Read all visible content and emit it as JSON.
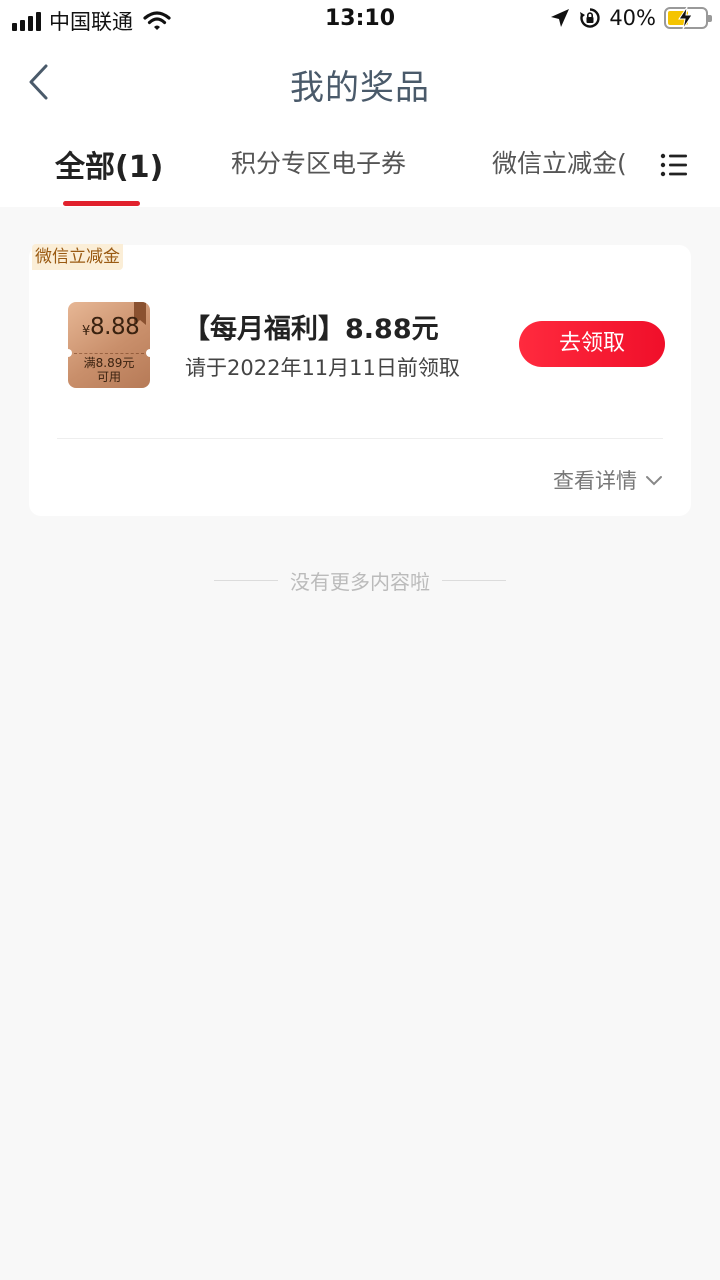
{
  "status_bar": {
    "carrier": "中国联通",
    "time": "13:10",
    "battery_percent": "40%",
    "battery_level": 0.4,
    "icons": [
      "signal-icon",
      "wifi-icon",
      "location-icon",
      "rotation-lock-icon",
      "battery-charging-icon"
    ]
  },
  "nav": {
    "title": "我的奖品",
    "back_icon": "chevron-left-icon"
  },
  "tabs": [
    {
      "label": "全部(1)",
      "active": true
    },
    {
      "label": "积分专区电子券",
      "active": false
    },
    {
      "label": "微信立减金(",
      "active": false
    }
  ],
  "tab_menu_icon": "list-menu-icon",
  "colors": {
    "accent": "#e1212d",
    "button": "#f5142d",
    "tag_text": "#9a5a12",
    "tag_bg": "#fbeed7",
    "background": "#f8f8f8"
  },
  "card": {
    "tag": "微信立减金",
    "coupon": {
      "currency": "¥",
      "amount": "8.88",
      "condition": "满8.89元",
      "condition2": "可用"
    },
    "title": "【每月福利】8.88元",
    "description": "请于2022年11月11日前领取",
    "claim_button": "去领取",
    "detail_link": "查看详情"
  },
  "footer": {
    "no_more": "没有更多内容啦"
  }
}
